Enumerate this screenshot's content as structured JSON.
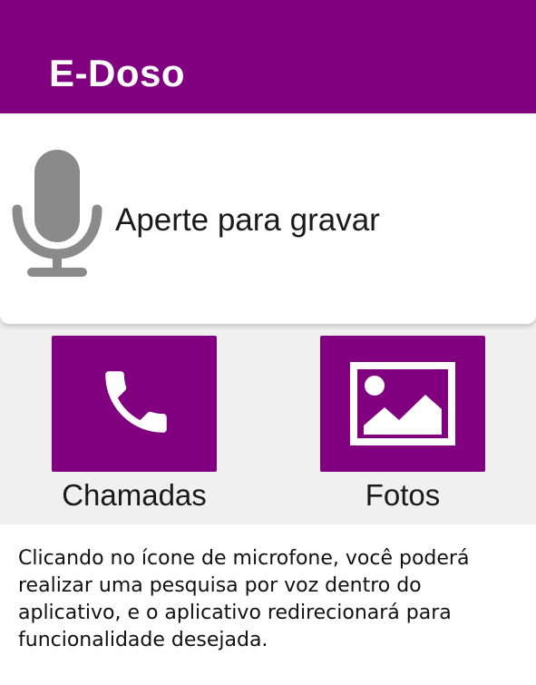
{
  "app": {
    "title": "E-Doso",
    "bar_color": "#800080"
  },
  "record": {
    "label": "Aperte para gravar",
    "icon": "microphone-icon"
  },
  "tiles": [
    {
      "label": "Chamadas",
      "icon": "phone-icon"
    },
    {
      "label": "Fotos",
      "icon": "image-icon"
    }
  ],
  "caption": "Clicando no ícone de microfone, você poderá realizar uma pesquisa por voz dentro do aplicativo, e o aplicativo redirecionará para funcionalidade desejada."
}
